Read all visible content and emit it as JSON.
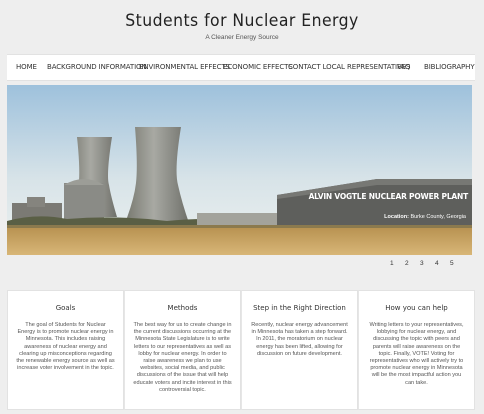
{
  "header": {
    "title": "Students for Nuclear Energy",
    "tagline": "A Cleaner Energy Source"
  },
  "nav": {
    "items": [
      {
        "label": "Home"
      },
      {
        "label": "Background Information"
      },
      {
        "label": "Environmental Effects"
      },
      {
        "label": "Economic Effects"
      },
      {
        "label": "Contact Local Representatives"
      },
      {
        "label": "FAQ"
      },
      {
        "label": "Bibliography"
      }
    ]
  },
  "slider": {
    "caption_title": "ALVIN VOGTLE NUCLEAR POWER PLANT",
    "location_label": "Location:",
    "location_value": "Burke County, Georgia",
    "pages": [
      "1",
      "2",
      "3",
      "4",
      "5"
    ]
  },
  "colors": {
    "sky_top": "#9ec1dc",
    "sky_bottom": "#eef2f0",
    "field": "#c9a25f",
    "tower": "#8e8f8a"
  },
  "cards": [
    {
      "title": "Goals",
      "body": "The goal of Students for Nuclear Energy is to promote nuclear energy in Minnesota. This includes raising awareness of nuclear energy and clearing up misconceptions regarding the renewable energy source as well as increase voter involvement in the topic."
    },
    {
      "title": "Methods",
      "body": "The best way for us to create change in the current discussions occurring at the Minnesota State Legislature is to write letters to our representatives as well as lobby for nuclear energy. In order to raise awareness we plan to use websites, social media, and public discussions of the issue that will help educate voters and incite interest in this controversial topic."
    },
    {
      "title": "Step in the Right Direction",
      "body": "Recently, nuclear energy advancement in Minnesota has taken a step forward. In 2011, the moratorium on nuclear energy has been lifted, allowing for discussion on future development."
    },
    {
      "title": "How you can help",
      "body": "Writing letters to your representatives, lobbying for nuclear energy, and discussing the topic with peers and parents will raise awareness on the topic. Finally, VOTE! Voting for representatives who will actively try to promote nuclear energy in Minnesota will be the most impactful action you can take."
    }
  ]
}
